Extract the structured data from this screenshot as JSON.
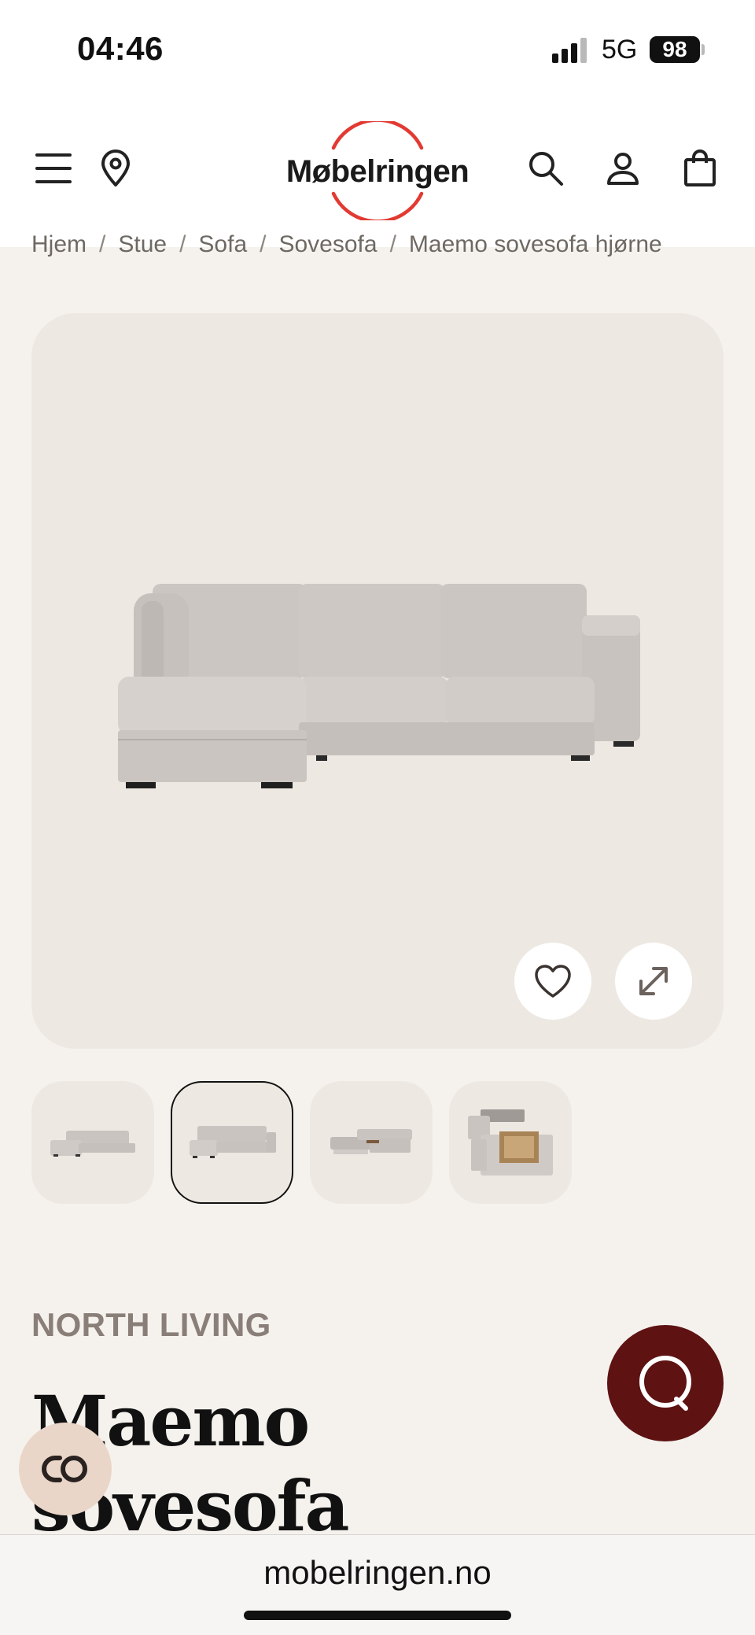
{
  "status_bar": {
    "time": "04:46",
    "network": "5G",
    "battery": "98"
  },
  "header": {
    "logo_text": "Møbelringen",
    "logo_ring_color": "#e23a32"
  },
  "breadcrumb": [
    "Hjem",
    "Stue",
    "Sofa",
    "Sovesofa",
    "Maemo sovesofa hjørne"
  ],
  "breadcrumb_separator": "/",
  "gallery": {
    "thumbnail_count": 4,
    "active_index": 1
  },
  "product": {
    "brand": "NORTH LIVING",
    "title": "Maemo sovesofa hjørne"
  },
  "browser": {
    "url": "mobelringen.no"
  },
  "colors": {
    "accent_chat": "#5e1212",
    "compare_bg": "#ead6c8",
    "brand_text": "#8a7f78"
  },
  "icons": [
    "menu-icon",
    "location-pin-icon",
    "search-icon",
    "user-icon",
    "shopping-bag-icon",
    "heart-icon",
    "expand-icon",
    "chat-icon",
    "compare-icon"
  ]
}
